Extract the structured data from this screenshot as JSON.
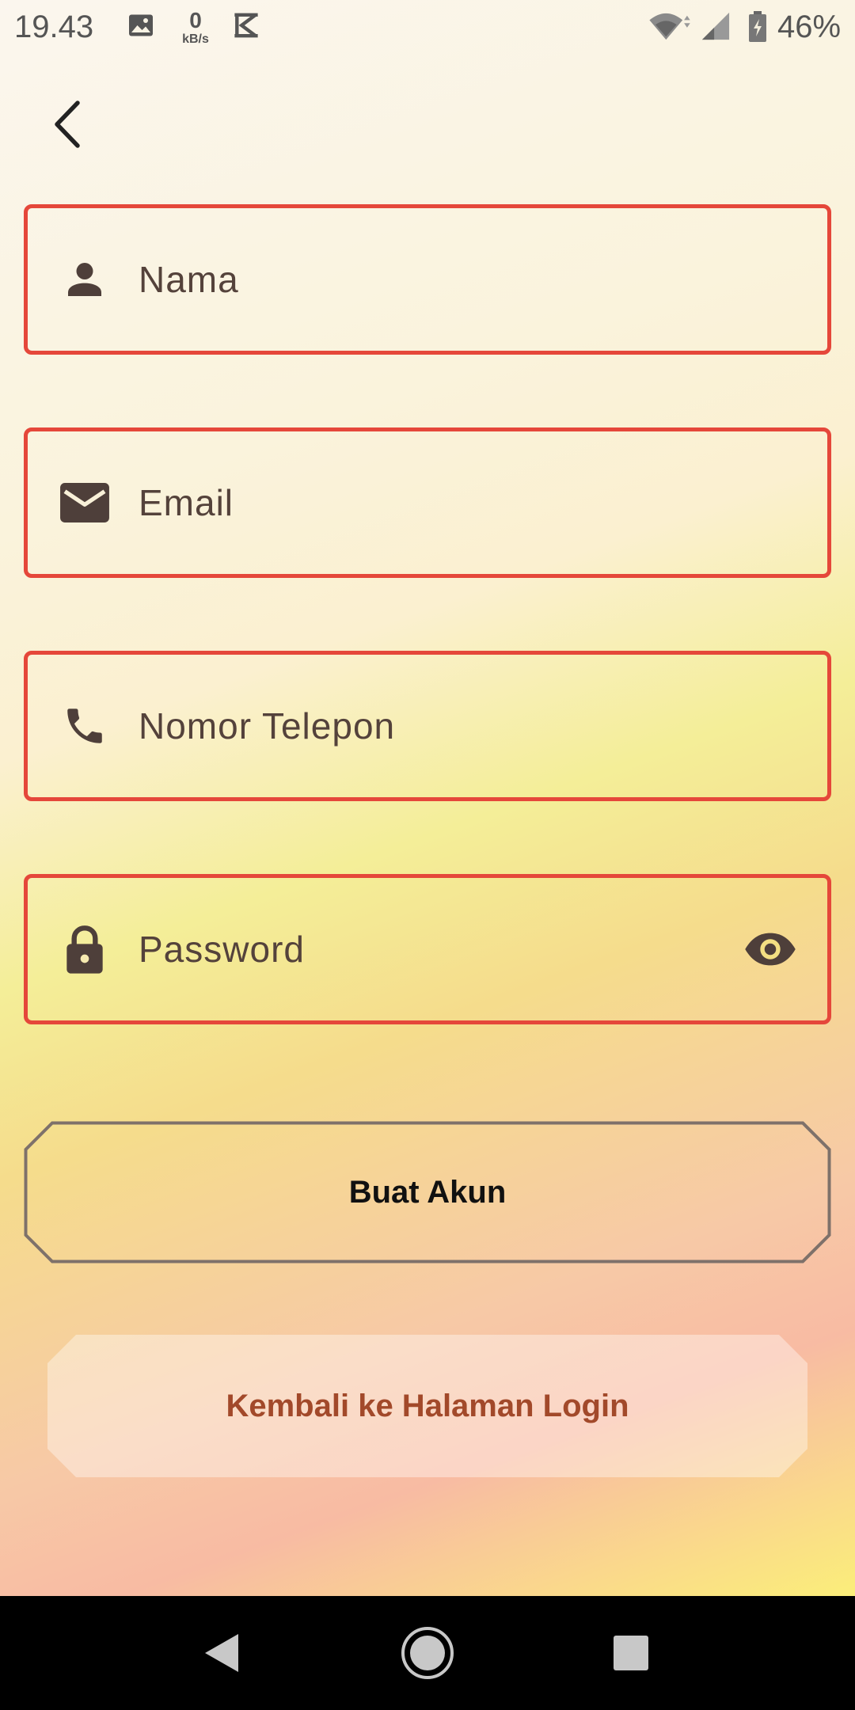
{
  "status_bar": {
    "time": "19.43",
    "net_speed_value": "0",
    "net_speed_unit": "kB/s",
    "battery": "46%",
    "icons": [
      "image-icon",
      "k-icon",
      "wifi-icon",
      "signal-icon",
      "battery-icon"
    ]
  },
  "form": {
    "back_icon": "chevron-left-icon",
    "fields": [
      {
        "placeholder": "Nama",
        "icon": "person-icon"
      },
      {
        "placeholder": "Email",
        "icon": "mail-icon"
      },
      {
        "placeholder": "Nomor Telepon",
        "icon": "phone-icon"
      },
      {
        "placeholder": "Password",
        "icon": "lock-icon",
        "trailing_icon": "eye-icon"
      }
    ],
    "create_label": "Buat Akun",
    "login_label": "Kembali ke Halaman Login"
  },
  "colors": {
    "field_border": "#e5473a",
    "icon": "#4e3f3a",
    "login_text": "#a2492a",
    "nav_bar": "#000000"
  },
  "nav_bar": {
    "buttons": [
      "back-triangle-icon",
      "home-circle-icon",
      "recent-square-icon"
    ]
  }
}
